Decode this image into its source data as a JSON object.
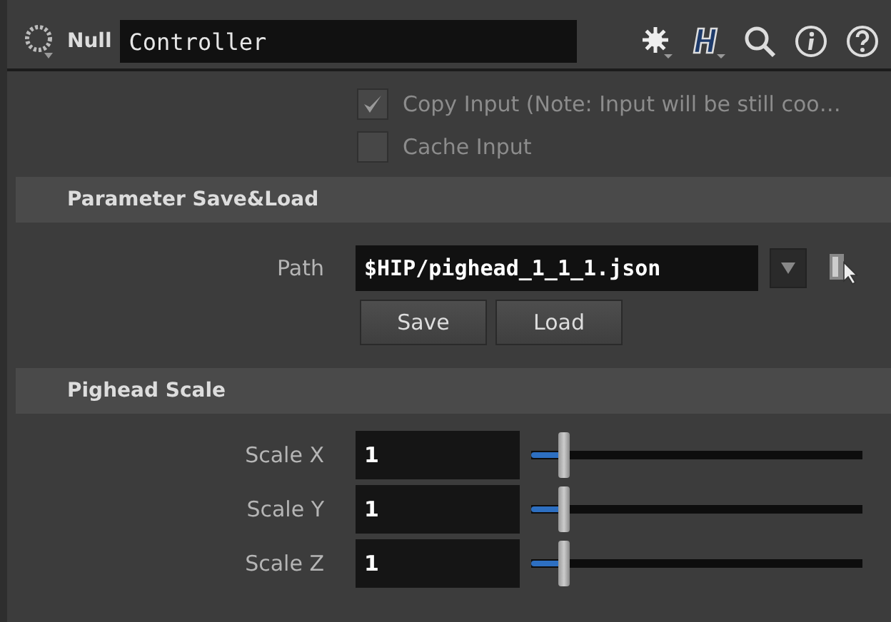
{
  "header": {
    "node_type": "Null",
    "node_name": "Controller"
  },
  "toggles": [
    {
      "label": "Copy Input (Note: Input will be still coo…",
      "checked": true,
      "disabled": true
    },
    {
      "label": "Cache Input",
      "checked": false,
      "disabled": true
    }
  ],
  "sections": [
    {
      "title": "Parameter Save&Load",
      "kind": "file",
      "path_label": "Path",
      "path_value": "$HIP/pighead_1_1_1.json",
      "buttons": [
        "Save",
        "Load"
      ]
    },
    {
      "title": "Pighead Scale",
      "kind": "sliders",
      "params": [
        {
          "label": "Scale X",
          "value": "1",
          "level": 0.1
        },
        {
          "label": "Scale Y",
          "value": "1",
          "level": 0.1
        },
        {
          "label": "Scale Z",
          "value": "1",
          "level": 0.1
        }
      ]
    }
  ]
}
